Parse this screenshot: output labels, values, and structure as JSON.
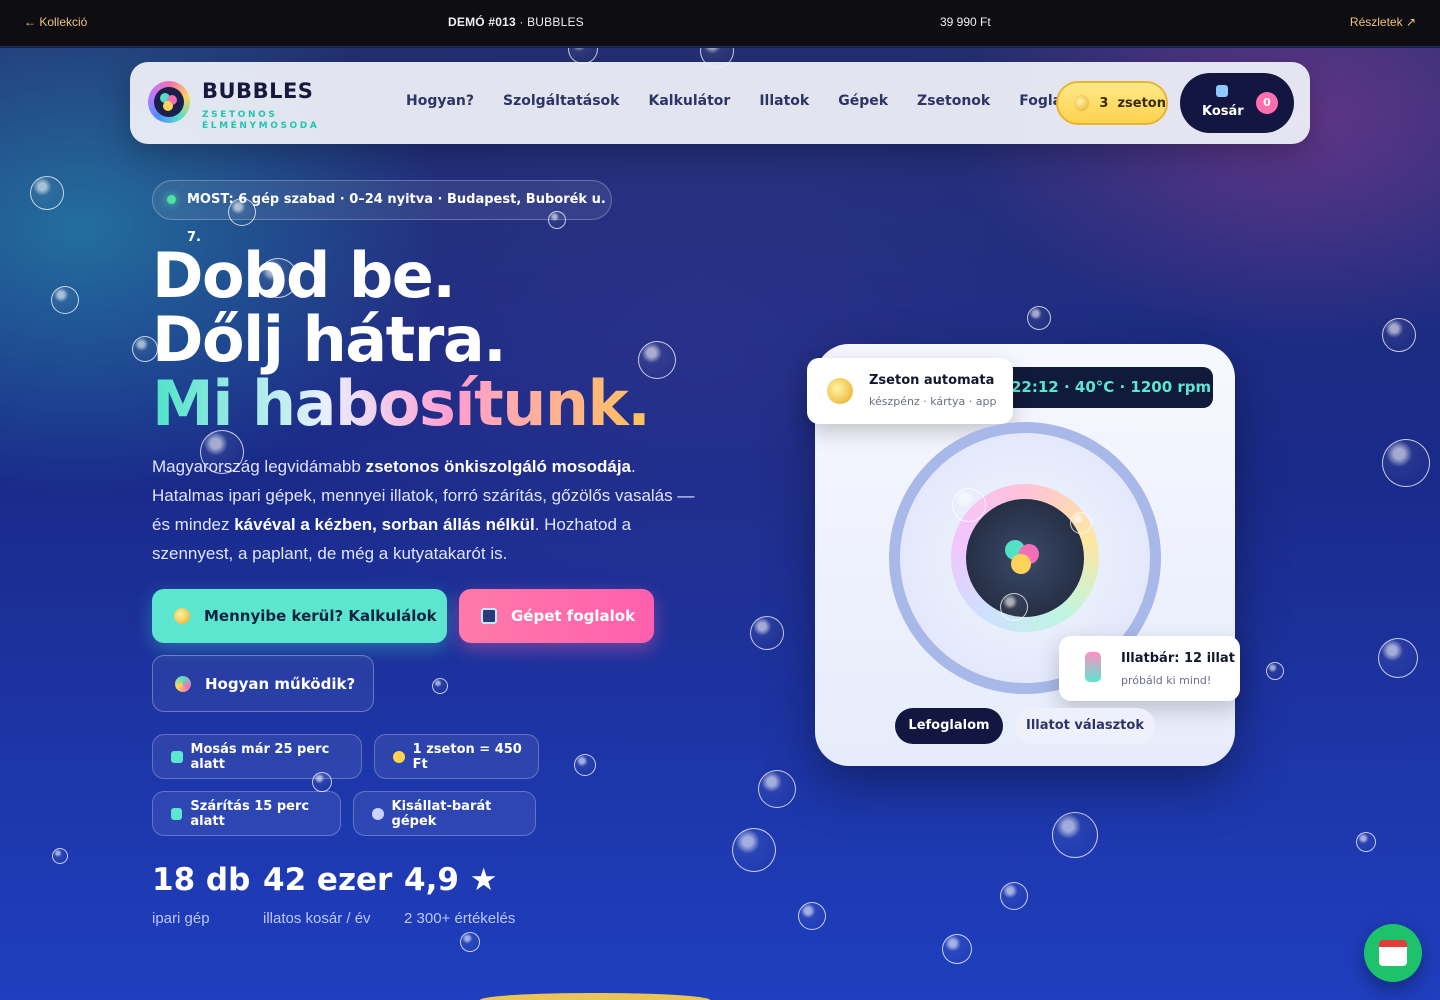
{
  "topbar": {
    "back": "← Kollekció",
    "title_strong": "DEMÓ #013",
    "title_rest": " · BUBBLES",
    "price": "39 990 Ft",
    "details": "Részletek ↗"
  },
  "nav": {
    "brand": "BUBBLES",
    "tagline": "ZSETONOS ÉLMÉNYMOSODA",
    "links": [
      "Hogyan?",
      "Szolgáltatások",
      "Kalkulátor",
      "Illatok",
      "Gépek",
      "Zsetonok",
      "Foglalás"
    ],
    "token_count": "3",
    "token_label": "zseton",
    "cart_label": "Kosár",
    "cart_count": "0"
  },
  "hero": {
    "status": "MOST: 6 gép szabad · 0–24 nyitva · Budapest, Buborék u. 7.",
    "headline_1": "Dobd be.",
    "headline_2": "Dőlj hátra.",
    "headline_3": "Mi habosítunk.",
    "lead_1": "Magyarország legvidámabb ",
    "lead_2": "zsetonos önkiszolgáló mosodája",
    "lead_3": ". Hatalmas ipari gépek, mennyei illatok, forró szárítás, gőzölős vasalás — és mindez ",
    "lead_4": "kávéval a kézben, sorban állás nélkül",
    "lead_5": ". Hozhatod a szennyest, a paplant, de még a kutyatakarót is.",
    "cta_calc": "Mennyibe kerül? Kalkulálok",
    "cta_book": "Gépet foglalok",
    "cta_how": "Hogyan működik?",
    "chips": [
      "Mosás már 25 perc alatt",
      "1 zseton = 450 Ft",
      "Szárítás 15 perc alatt",
      "Kisállat-barát gépek"
    ],
    "stats": [
      {
        "num": "18 db",
        "label": "ipari gép"
      },
      {
        "num": "42 ezer",
        "label": "illatos kosár / év"
      },
      {
        "num": "4,9 ★",
        "label": "2 300+ értékelés"
      }
    ]
  },
  "machine": {
    "readout": "22:12 · 40°C · 1200 rpm",
    "token_title": "Zseton automata",
    "token_sub": "készpénz · kártya · app",
    "scent_title": "Illatbár: 12 illat",
    "scent_sub": "próbáld ki mind!",
    "btn_book": "Lefoglalom",
    "btn_scent": "Illatot választok"
  },
  "colors": {
    "accent_mint": "#5ce6cf",
    "accent_pink": "#ff6fae",
    "accent_gold": "#ffd34e",
    "navy": "#121640"
  },
  "icons": [
    "logo-icon",
    "coin-icon",
    "cart-icon",
    "calendar-icon",
    "soap-bottle-icon",
    "washing-machine-icon"
  ]
}
